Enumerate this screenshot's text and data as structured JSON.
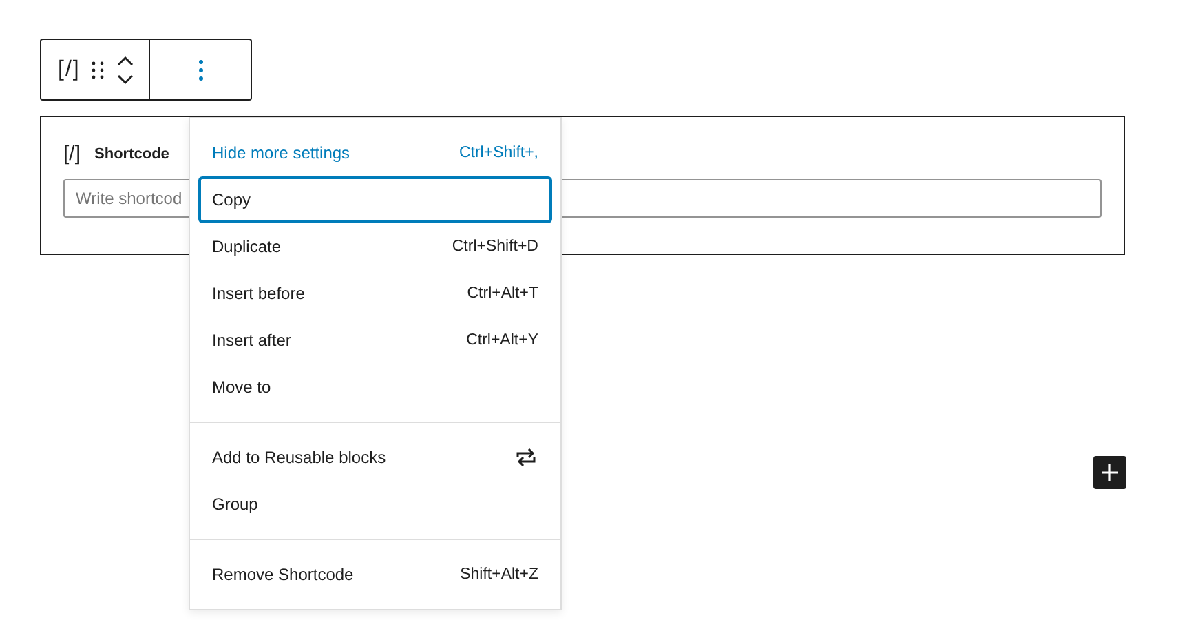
{
  "toolbar": {
    "block_icon": "[/]",
    "more_selected": true
  },
  "block": {
    "icon": "[/]",
    "title": "Shortcode",
    "input": {
      "placeholder": "Write shortcod"
    }
  },
  "menu": {
    "groups": [
      {
        "items": [
          {
            "label": "Hide more settings",
            "kind": "toggle",
            "shortcut": "Ctrl+Shift+,",
            "selected": false
          },
          {
            "label": "Copy",
            "kind": "plain",
            "selected": true
          },
          {
            "label": "Duplicate",
            "kind": "plain",
            "shortcut": "Ctrl+Shift+D",
            "selected": false
          },
          {
            "label": "Insert before",
            "kind": "plain",
            "shortcut": "Ctrl+Alt+T",
            "selected": false
          },
          {
            "label": "Insert after",
            "kind": "plain",
            "shortcut": "Ctrl+Alt+Y",
            "selected": false
          },
          {
            "label": "Move to",
            "kind": "plain",
            "selected": false
          }
        ]
      },
      {
        "items": [
          {
            "label": "Add to Reusable blocks",
            "kind": "reusable",
            "selected": false
          },
          {
            "label": "Group",
            "kind": "plain",
            "selected": false
          }
        ]
      },
      {
        "items": [
          {
            "label": "Remove Shortcode",
            "kind": "plain",
            "shortcut": "Shift+Alt+Z",
            "selected": false
          }
        ]
      }
    ]
  }
}
